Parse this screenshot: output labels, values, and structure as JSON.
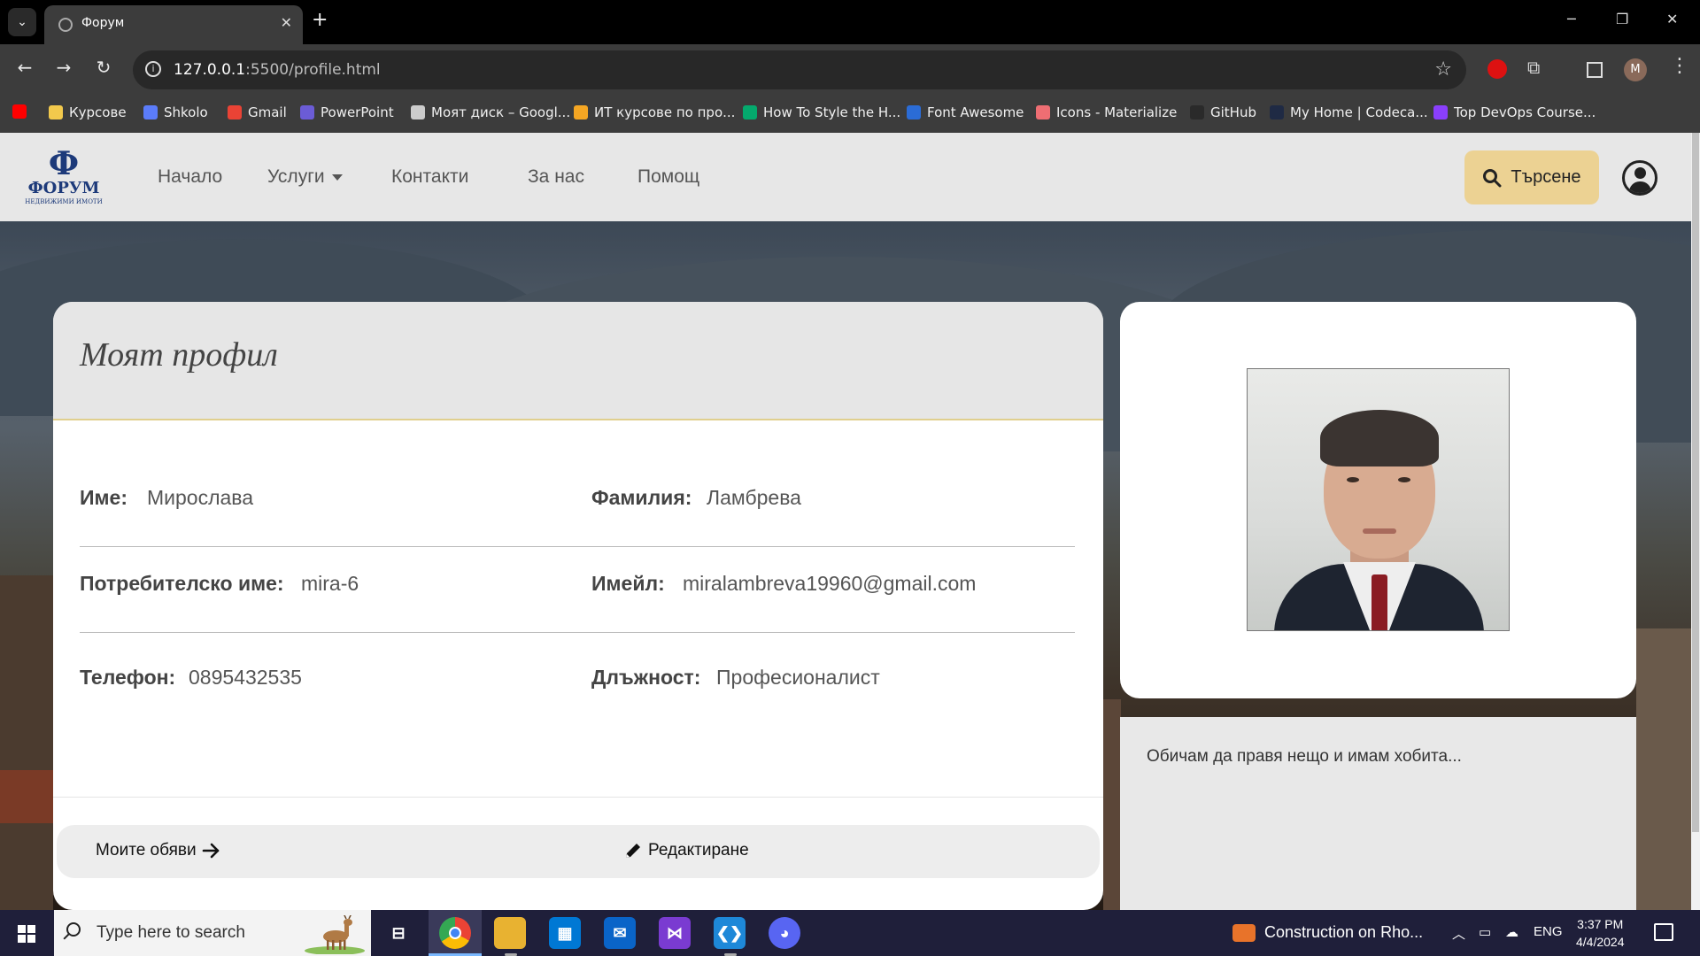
{
  "browser": {
    "tab_title": "Форум",
    "url_host": "127.0.0.1",
    "url_rest": ":5500/profile.html",
    "profile_initial": "M",
    "bookmarks": [
      {
        "label": "",
        "color": "#ff0000"
      },
      {
        "label": "Курсове",
        "color": "#f2c94c"
      },
      {
        "label": "Shkolo",
        "color": "#5b7cfa"
      },
      {
        "label": "Gmail",
        "color": "#ea4335"
      },
      {
        "label": "PowerPoint",
        "color": "#6b5cd6"
      },
      {
        "label": "Моят диск – Googl...",
        "color": "#cccccc"
      },
      {
        "label": "ИТ курсове по про...",
        "color": "#f5a623"
      },
      {
        "label": "How To Style the H...",
        "color": "#04aa6d"
      },
      {
        "label": "Font Awesome",
        "color": "#2b6cd6"
      },
      {
        "label": "Icons - Materialize",
        "color": "#ee6e73"
      },
      {
        "label": "GitHub",
        "color": "#2a2a2a"
      },
      {
        "label": "My Home | Codeca...",
        "color": "#1f2a44"
      },
      {
        "label": "Top DevOps Course...",
        "color": "#8a3ffc"
      }
    ]
  },
  "site": {
    "logo_text": "ФОРУМ",
    "logo_sub": "НЕДВИЖИМИ ИМОТИ",
    "logo_emblem": "Ф",
    "nav": [
      "Начало",
      "Услуги",
      "Контакти",
      "За нас",
      "Помощ"
    ],
    "search_label": "Търсене"
  },
  "profile": {
    "title": "Моят профил",
    "fields": {
      "first_name": {
        "label": "Име:",
        "value": "Мирослава"
      },
      "last_name": {
        "label": "Фамилия:",
        "value": "Ламбрева"
      },
      "username": {
        "label": "Потребителско име:",
        "value": "mira-6"
      },
      "email": {
        "label": "Имейл:",
        "value": "miralambreva19960@gmail.com"
      },
      "phone": {
        "label": "Телефон:",
        "value": "0895432535"
      },
      "position": {
        "label": "Длъжност:",
        "value": "Професионалист"
      }
    },
    "my_ads_label": "Моите обяви",
    "edit_label": "Редактиране",
    "bio": "Обичам да правя нещо и имам хобита..."
  },
  "taskbar": {
    "search_placeholder": "Type here to search",
    "news": "Construction on Rho...",
    "language": "ENG",
    "time": "3:37 PM",
    "date": "4/4/2024"
  }
}
